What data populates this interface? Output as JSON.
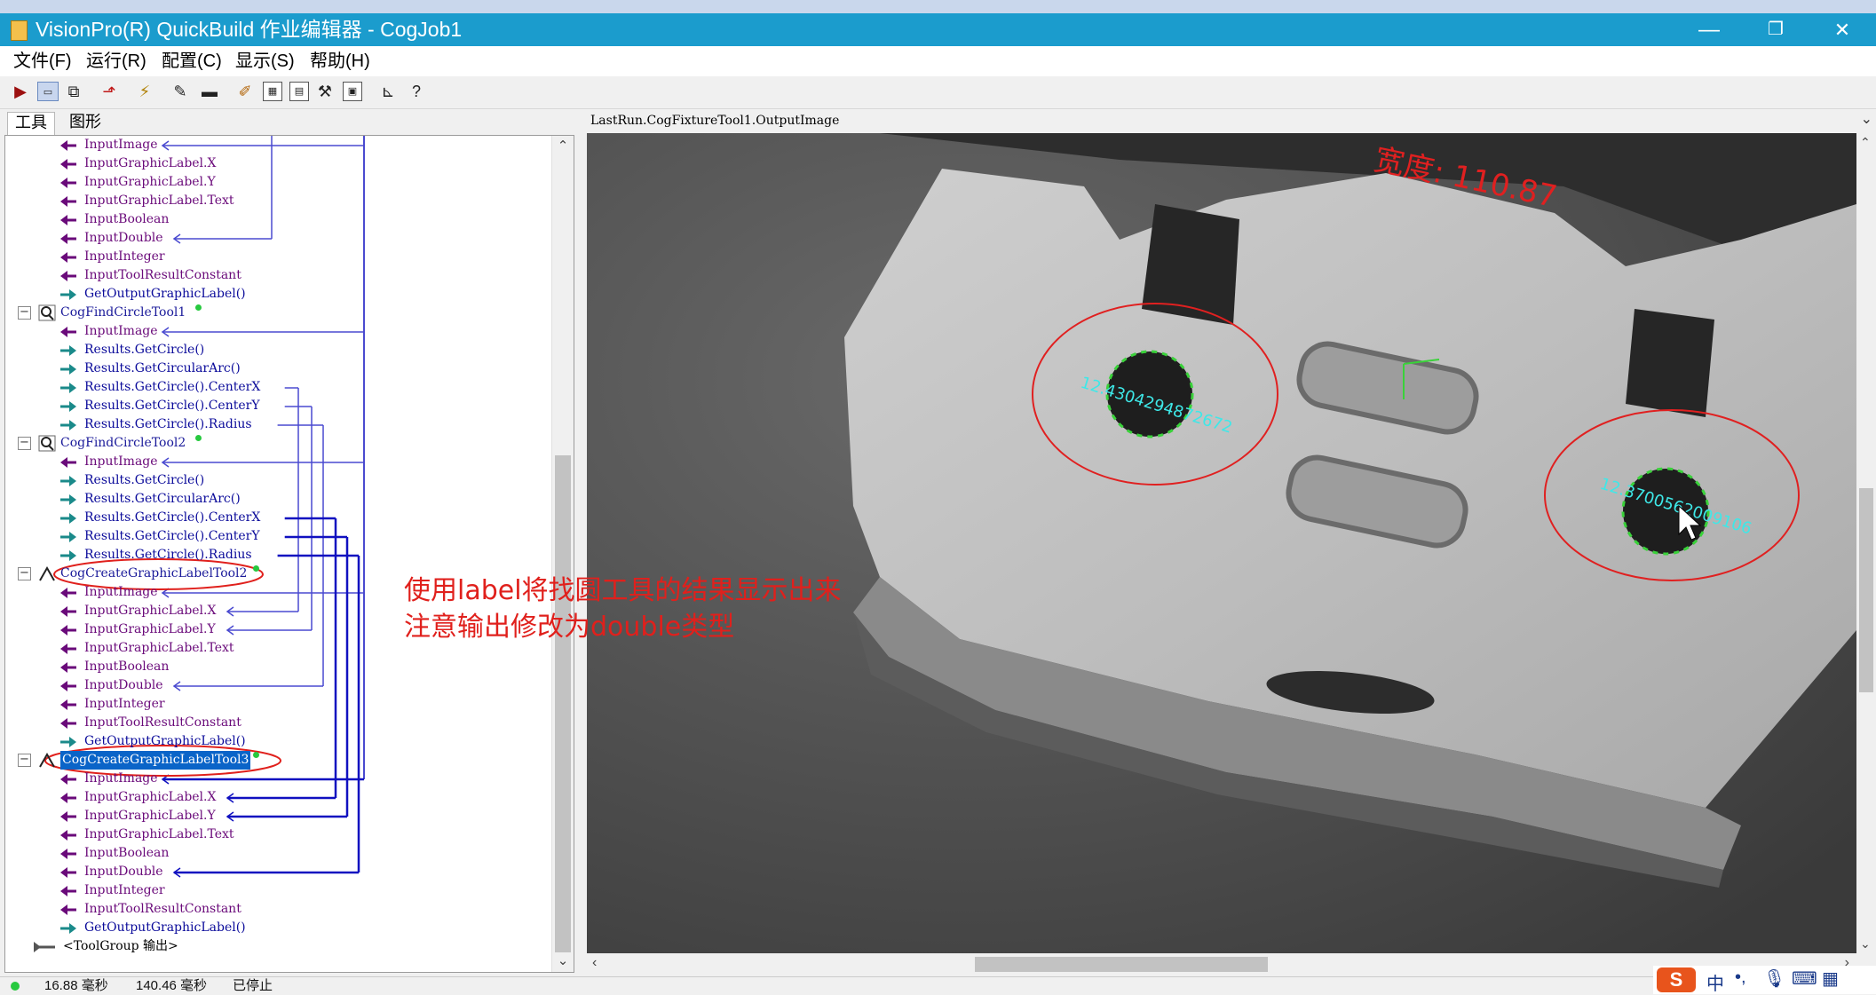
{
  "window": {
    "title": "VisionPro(R) QuickBuild 作业编辑器 - CogJob1",
    "minimize": "—",
    "restore": "❐",
    "close": "✕"
  },
  "menu": [
    "文件(F)",
    "运行(R)",
    "配置(C)",
    "显示(S)",
    "帮助(H)"
  ],
  "tabs": {
    "tools": "工具",
    "graphics": "图形"
  },
  "tree": [
    {
      "text": "InputImage",
      "kind": "in"
    },
    {
      "text": "InputGraphicLabel.X",
      "kind": "in"
    },
    {
      "text": "InputGraphicLabel.Y",
      "kind": "in"
    },
    {
      "text": "InputGraphicLabel.Text",
      "kind": "in"
    },
    {
      "text": "InputBoolean",
      "kind": "in"
    },
    {
      "text": "InputDouble",
      "kind": "in"
    },
    {
      "text": "InputInteger",
      "kind": "in"
    },
    {
      "text": "InputToolResultConstant",
      "kind": "in"
    },
    {
      "text": "GetOutputGraphicLabel()",
      "kind": "out"
    },
    {
      "text": "CogFindCircleTool1",
      "kind": "tool",
      "icon": "magnifier"
    },
    {
      "text": "InputImage",
      "kind": "in"
    },
    {
      "text": "Results.GetCircle()",
      "kind": "out"
    },
    {
      "text": "Results.GetCircularArc()",
      "kind": "out"
    },
    {
      "text": "Results.GetCircle().CenterX",
      "kind": "out"
    },
    {
      "text": "Results.GetCircle().CenterY",
      "kind": "out"
    },
    {
      "text": "Results.GetCircle().Radius",
      "kind": "out"
    },
    {
      "text": "CogFindCircleTool2",
      "kind": "tool",
      "icon": "magnifier"
    },
    {
      "text": "InputImage",
      "kind": "in"
    },
    {
      "text": "Results.GetCircle()",
      "kind": "out"
    },
    {
      "text": "Results.GetCircularArc()",
      "kind": "out"
    },
    {
      "text": "Results.GetCircle().CenterX",
      "kind": "out"
    },
    {
      "text": "Results.GetCircle().CenterY",
      "kind": "out"
    },
    {
      "text": "Results.GetCircle().Radius",
      "kind": "out"
    },
    {
      "text": "CogCreateGraphicLabelTool2",
      "kind": "tool",
      "icon": "label"
    },
    {
      "text": "InputImage",
      "kind": "in"
    },
    {
      "text": "InputGraphicLabel.X",
      "kind": "in"
    },
    {
      "text": "InputGraphicLabel.Y",
      "kind": "in"
    },
    {
      "text": "InputGraphicLabel.Text",
      "kind": "in"
    },
    {
      "text": "InputBoolean",
      "kind": "in"
    },
    {
      "text": "InputDouble",
      "kind": "in"
    },
    {
      "text": "InputInteger",
      "kind": "in"
    },
    {
      "text": "InputToolResultConstant",
      "kind": "in"
    },
    {
      "text": "GetOutputGraphicLabel()",
      "kind": "out"
    },
    {
      "text": "CogCreateGraphicLabelTool3",
      "kind": "tool",
      "icon": "label",
      "selected": true
    },
    {
      "text": "InputImage",
      "kind": "in"
    },
    {
      "text": "InputGraphicLabel.X",
      "kind": "in"
    },
    {
      "text": "InputGraphicLabel.Y",
      "kind": "in"
    },
    {
      "text": "InputGraphicLabel.Text",
      "kind": "in"
    },
    {
      "text": "InputBoolean",
      "kind": "in"
    },
    {
      "text": "InputDouble",
      "kind": "in"
    },
    {
      "text": "InputInteger",
      "kind": "in"
    },
    {
      "text": "InputToolResultConstant",
      "kind": "in"
    },
    {
      "text": "GetOutputGraphicLabel()",
      "kind": "out"
    },
    {
      "text": "<ToolGroup 输出>",
      "kind": "group"
    }
  ],
  "viewer": {
    "title": "LastRun.CogFixtureTool1.OutputImage",
    "width_label": "宽度:  110.87",
    "label1": "12.4304294872672",
    "label2": "12.3700562009106"
  },
  "annotation": {
    "line1": "使用label将找圆工具的结果显示出来",
    "line2": "注意输出修改为double类型"
  },
  "status": [
    "16.88 毫秒",
    "140.46 毫秒",
    "已停止"
  ],
  "colors": {
    "titlebar": "#1b9ccd",
    "annotation": "#e0201c",
    "selection": "#0a64c8",
    "label_cyan": "#3ee8e8"
  }
}
